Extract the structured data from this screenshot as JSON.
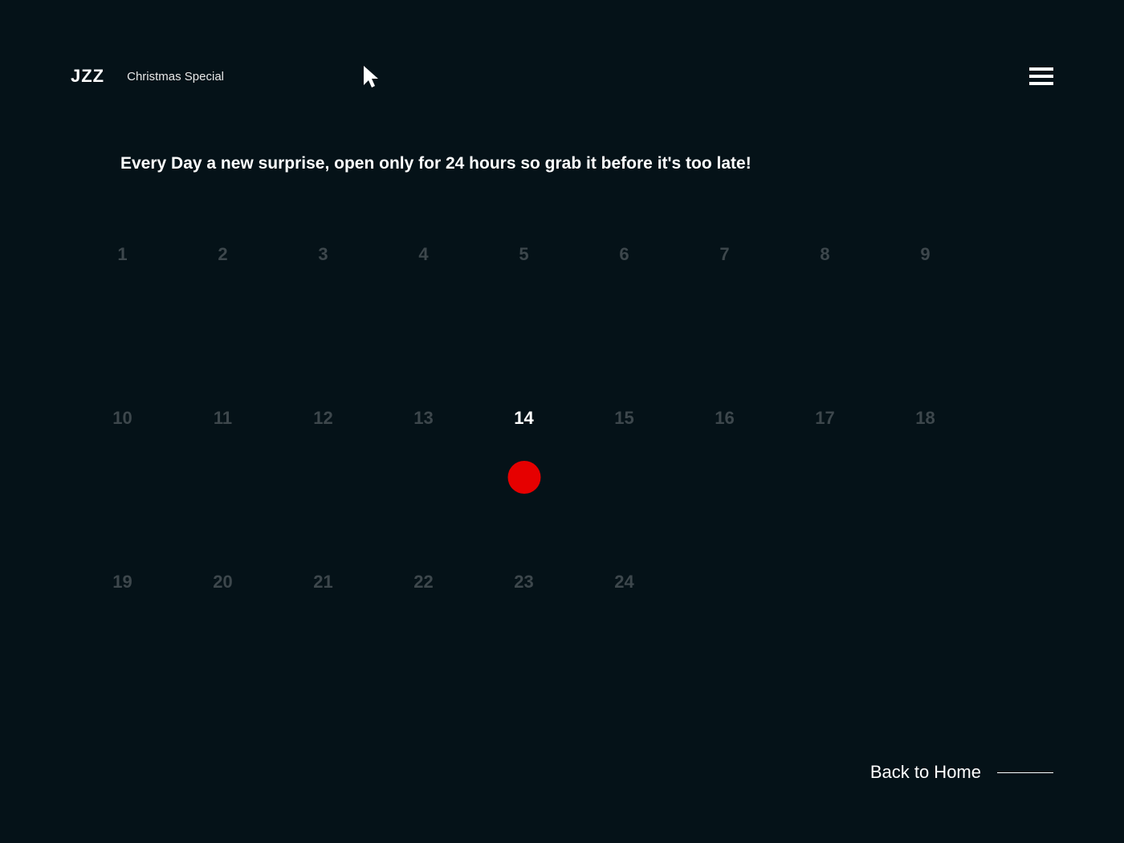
{
  "header": {
    "logo": "JZZ",
    "title": "Christmas Special"
  },
  "main": {
    "tagline": "Every Day a new surprise, open only for 24 hours so grab it before it's too late!"
  },
  "calendar": {
    "row1": [
      "1",
      "2",
      "3",
      "4",
      "5",
      "6",
      "7",
      "8",
      "9"
    ],
    "row2": [
      "10",
      "11",
      "12",
      "13",
      "14",
      "15",
      "16",
      "17",
      "18"
    ],
    "row3": [
      "19",
      "20",
      "21",
      "22",
      "23",
      "24"
    ],
    "active_day": "14"
  },
  "footer": {
    "back_home": "Back to Home"
  },
  "colors": {
    "background": "#051218",
    "accent": "#e60000",
    "text_active": "#ffffff",
    "text_muted": "#3d474c"
  }
}
